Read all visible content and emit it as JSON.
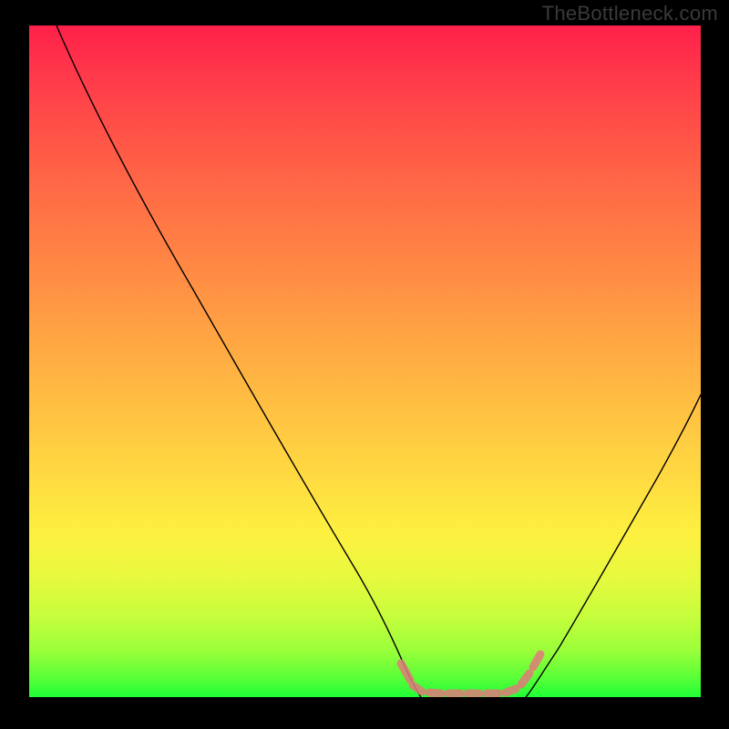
{
  "watermark": "TheBottleneck.com",
  "domain": "Chart",
  "chart_data": {
    "type": "line",
    "title": "",
    "xlabel": "",
    "ylabel": "",
    "x_range": [
      0,
      1
    ],
    "y_range": [
      0,
      1
    ],
    "gradient_stops": [
      {
        "pos": 0.0,
        "color": "#ff204a"
      },
      {
        "pos": 0.5,
        "color": "#ffc342"
      },
      {
        "pos": 0.8,
        "color": "#fdf140"
      },
      {
        "pos": 1.0,
        "color": "#1fff36"
      }
    ],
    "series": [
      {
        "name": "left-curve",
        "type": "line",
        "points": [
          {
            "x": 0.04,
            "y": 1.0
          },
          {
            "x": 0.1,
            "y": 0.92
          },
          {
            "x": 0.18,
            "y": 0.79
          },
          {
            "x": 0.27,
            "y": 0.64
          },
          {
            "x": 0.36,
            "y": 0.48
          },
          {
            "x": 0.44,
            "y": 0.32
          },
          {
            "x": 0.52,
            "y": 0.15
          },
          {
            "x": 0.56,
            "y": 0.05
          },
          {
            "x": 0.58,
            "y": 0.0
          }
        ]
      },
      {
        "name": "right-curve",
        "type": "line",
        "points": [
          {
            "x": 0.74,
            "y": 0.0
          },
          {
            "x": 0.77,
            "y": 0.05
          },
          {
            "x": 0.82,
            "y": 0.14
          },
          {
            "x": 0.88,
            "y": 0.26
          },
          {
            "x": 0.94,
            "y": 0.38
          },
          {
            "x": 1.0,
            "y": 0.5
          }
        ]
      },
      {
        "name": "optimal-band",
        "type": "band",
        "style": "dashed-pink",
        "x_start": 0.55,
        "x_end": 0.76,
        "y": 0.0
      }
    ]
  }
}
